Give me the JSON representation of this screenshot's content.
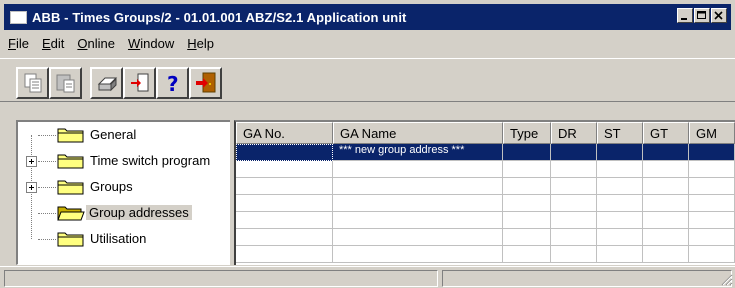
{
  "window": {
    "title": "ABB - Times Groups/2 - 01.01.001 ABZ/S2.1 Application unit"
  },
  "menu": [
    {
      "label": "File",
      "key": "F"
    },
    {
      "label": "Edit",
      "key": "E"
    },
    {
      "label": "Online",
      "key": "O"
    },
    {
      "label": "Window",
      "key": "W"
    },
    {
      "label": "Help",
      "key": "H"
    }
  ],
  "toolbar": {
    "buttons": [
      {
        "icon": "copy-icon"
      },
      {
        "icon": "paste-icon"
      },
      {
        "icon": "print-icon"
      },
      {
        "icon": "import-icon"
      },
      {
        "icon": "help-icon"
      },
      {
        "icon": "exit-icon"
      }
    ]
  },
  "tree": {
    "items": [
      {
        "label": "General",
        "expandable": false,
        "selected": false
      },
      {
        "label": "Time switch program",
        "expandable": true,
        "selected": false
      },
      {
        "label": "Groups",
        "expandable": true,
        "selected": false
      },
      {
        "label": "Group addresses",
        "expandable": false,
        "selected": true
      },
      {
        "label": "Utilisation",
        "expandable": false,
        "selected": false
      }
    ]
  },
  "grid": {
    "columns": [
      "GA No.",
      "GA Name",
      "Type",
      "DR",
      "ST",
      "GT",
      "GM"
    ],
    "rows": [
      {
        "cells": [
          "",
          "*** new group address ***",
          "",
          "",
          "",
          "",
          ""
        ],
        "selected": true
      }
    ]
  },
  "colors": {
    "titlebar": "#0a246a",
    "face": "#d4d0c8",
    "selection": "#0a246a"
  }
}
